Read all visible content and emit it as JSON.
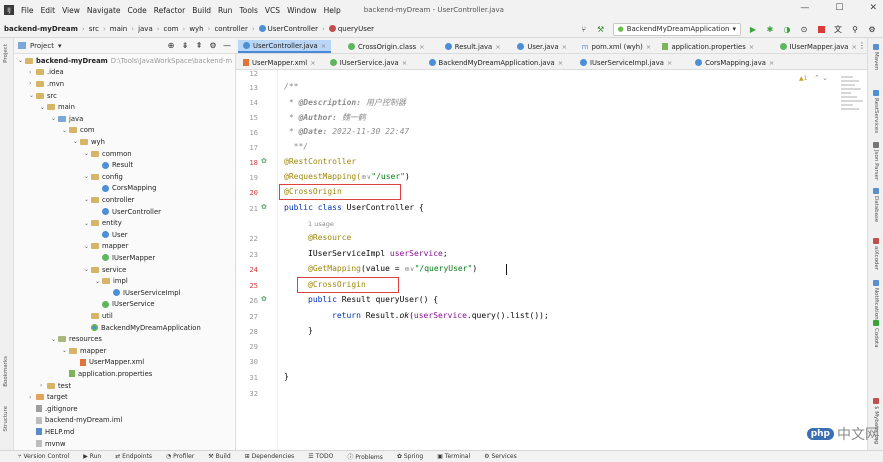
{
  "menubar": {
    "items": [
      "File",
      "Edit",
      "View",
      "Navigate",
      "Code",
      "Refactor",
      "Build",
      "Run",
      "Tools",
      "VCS",
      "Window",
      "Help"
    ],
    "window_title": "backend-myDream - UserController.java"
  },
  "window_controls": [
    "—",
    "☐",
    "✕"
  ],
  "navbar": {
    "crumbs": [
      "backend-myDream",
      "src",
      "main",
      "java",
      "com",
      "wyh",
      "controller",
      "UserController",
      "queryUser"
    ],
    "run_config": "BackendMyDreamApplication"
  },
  "project_panel": {
    "title": "Project"
  },
  "tree": [
    {
      "label": "backend-myDream",
      "hint": "D:\\Tools\\JavaWorkSpace\\backend-m",
      "depth": 0,
      "arrow": "v",
      "icon": "folder",
      "bold": true
    },
    {
      "label": ".idea",
      "depth": 1,
      "arrow": ">",
      "icon": "folder"
    },
    {
      "label": ".mvn",
      "depth": 1,
      "arrow": ">",
      "icon": "folder"
    },
    {
      "label": "src",
      "depth": 1,
      "arrow": "v",
      "icon": "folder"
    },
    {
      "label": "main",
      "depth": 2,
      "arrow": "v",
      "icon": "folder"
    },
    {
      "label": "java",
      "depth": 3,
      "arrow": "v",
      "icon": "folder src"
    },
    {
      "label": "com",
      "depth": 4,
      "arrow": "v",
      "icon": "folder"
    },
    {
      "label": "wyh",
      "depth": 5,
      "arrow": "v",
      "icon": "folder"
    },
    {
      "label": "common",
      "depth": 6,
      "arrow": "v",
      "icon": "folder"
    },
    {
      "label": "Result",
      "depth": 7,
      "arrow": "",
      "icon": "cls"
    },
    {
      "label": "config",
      "depth": 6,
      "arrow": "v",
      "icon": "folder"
    },
    {
      "label": "CorsMapping",
      "depth": 7,
      "arrow": "",
      "icon": "cls"
    },
    {
      "label": "controller",
      "depth": 6,
      "arrow": "v",
      "icon": "folder"
    },
    {
      "label": "UserController",
      "depth": 7,
      "arrow": "",
      "icon": "cls"
    },
    {
      "label": "entity",
      "depth": 6,
      "arrow": "v",
      "icon": "folder"
    },
    {
      "label": "User",
      "depth": 7,
      "arrow": "",
      "icon": "cls"
    },
    {
      "label": "mapper",
      "depth": 6,
      "arrow": "v",
      "icon": "folder"
    },
    {
      "label": "IUserMapper",
      "depth": 7,
      "arrow": "",
      "icon": "iface"
    },
    {
      "label": "service",
      "depth": 6,
      "arrow": "v",
      "icon": "folder"
    },
    {
      "label": "impl",
      "depth": 7,
      "arrow": "v",
      "icon": "folder"
    },
    {
      "label": "IUserServiceImpl",
      "depth": 8,
      "arrow": "",
      "icon": "cls"
    },
    {
      "label": "IUserService",
      "depth": 7,
      "arrow": "",
      "icon": "iface"
    },
    {
      "label": "util",
      "depth": 6,
      "arrow": "",
      "icon": "folder"
    },
    {
      "label": "BackendMyDreamApplication",
      "depth": 6,
      "arrow": "",
      "icon": "cls spring"
    },
    {
      "label": "resources",
      "depth": 3,
      "arrow": "v",
      "icon": "folder res"
    },
    {
      "label": "mapper",
      "depth": 4,
      "arrow": "v",
      "icon": "folder"
    },
    {
      "label": "UserMapper.xml",
      "depth": 5,
      "arrow": "",
      "icon": "xmlf"
    },
    {
      "label": "application.properties",
      "depth": 4,
      "arrow": "",
      "icon": "propf"
    },
    {
      "label": "test",
      "depth": 2,
      "arrow": ">",
      "icon": "folder"
    },
    {
      "label": "target",
      "depth": 1,
      "arrow": ">",
      "icon": "folder tgt"
    },
    {
      "label": ".gitignore",
      "depth": 1,
      "arrow": "",
      "icon": "gitf"
    },
    {
      "label": "backend-myDream.iml",
      "depth": 1,
      "arrow": "",
      "icon": "file"
    },
    {
      "label": "HELP.md",
      "depth": 1,
      "arrow": "",
      "icon": "mdf"
    },
    {
      "label": "mvnw",
      "depth": 1,
      "arrow": "",
      "icon": "file"
    }
  ],
  "tabs_row1": [
    {
      "label": "UserController.java",
      "icon": "cls",
      "active": true
    },
    {
      "label": "CrossOrigin.class",
      "icon": "iface"
    },
    {
      "label": "Result.java",
      "icon": "cls"
    },
    {
      "label": "User.java",
      "icon": "cls"
    },
    {
      "label": "pom.xml (wyh)",
      "icon": "m"
    },
    {
      "label": "application.properties",
      "icon": "propf"
    },
    {
      "label": "IUserMapper.java",
      "icon": "iface"
    }
  ],
  "tabs_row2": [
    {
      "label": "UserMapper.xml",
      "icon": "xmlf"
    },
    {
      "label": "IUserService.java",
      "icon": "iface"
    },
    {
      "label": "BackendMyDreamApplication.java",
      "icon": "cls"
    },
    {
      "label": "IUserServiceImpl.java",
      "icon": "cls"
    },
    {
      "label": "CorsMapping.java",
      "icon": "cls"
    }
  ],
  "editor": {
    "line_numbers": [
      "12",
      "13",
      "14",
      "15",
      "16",
      "17",
      "18",
      "19",
      "20",
      "21",
      "",
      "22",
      "23",
      "24",
      "25",
      "26",
      "27",
      "28",
      "29",
      "30",
      "31",
      "32"
    ],
    "doc_open": "/**",
    "desc_tag": "@Description:",
    "desc_text": "用户控制器",
    "author_tag": "@Author:",
    "author_text": "魏一鹤",
    "date_tag": "@Date:",
    "date_text": "2022-11-30 22:47",
    "doc_close": "**/",
    "ann_rest": "@RestController",
    "ann_reqmap": "@RequestMapping(",
    "reqmap_path": "\"/user\"",
    "ann_cross": "@CrossOrigin",
    "kw_public": "public",
    "kw_class": "class",
    "class_name": "UserController {",
    "usages": "1 usage",
    "ann_resource": "@Resource",
    "field_type": "IUserServiceImpl",
    "field_name": "userService",
    "ann_getmap": "@GetMapping",
    "getmap_value": "(value = ",
    "getmap_path": "\"/queryUser\"",
    "method_sig": "Result queryUser() {",
    "kw_return": "return",
    "ret_expr_a": "Result.",
    "ret_expr_ok": "ok",
    "ret_expr_b": "(",
    "ret_expr_c": ".query().list());",
    "brace": "}",
    "inlay_hint": "⊕∨"
  },
  "status_bar": [
    "Version Control",
    "Run",
    "Endpoints",
    "Profiler",
    "Build",
    "Dependencies",
    "TODO",
    "Problems",
    "Spring",
    "Terminal",
    "Services"
  ],
  "left_strip": {
    "top": "Project",
    "middle": "Bookmarks",
    "bottom": "Structure"
  },
  "right_strip": [
    "Maven",
    "RestServices",
    "Json Parser",
    "Database",
    "aiXcoder",
    "Notifications",
    "Codota",
    "$ Mybatis Log"
  ],
  "inspection": {
    "warn": "▲1"
  },
  "watermark": {
    "badge": "php",
    "text": "中文网"
  }
}
